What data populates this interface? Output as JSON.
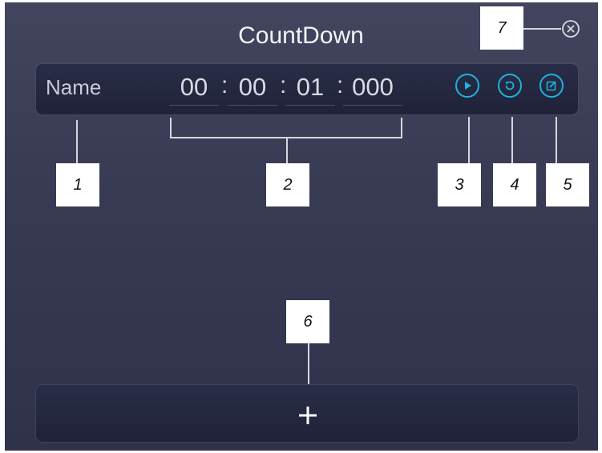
{
  "window": {
    "title": "CountDown"
  },
  "timer": {
    "name": "Name",
    "hours": "00",
    "minutes": "00",
    "seconds": "01",
    "milliseconds": "000",
    "separator": ":"
  },
  "annotations": [
    "1",
    "2",
    "3",
    "4",
    "5",
    "6",
    "7"
  ],
  "colors": {
    "accent": "#1db3df",
    "panel": "#3a3c56",
    "row": "#232640"
  },
  "icons": [
    "play-icon",
    "reset-icon",
    "edit-icon",
    "plus-icon",
    "close-icon"
  ]
}
